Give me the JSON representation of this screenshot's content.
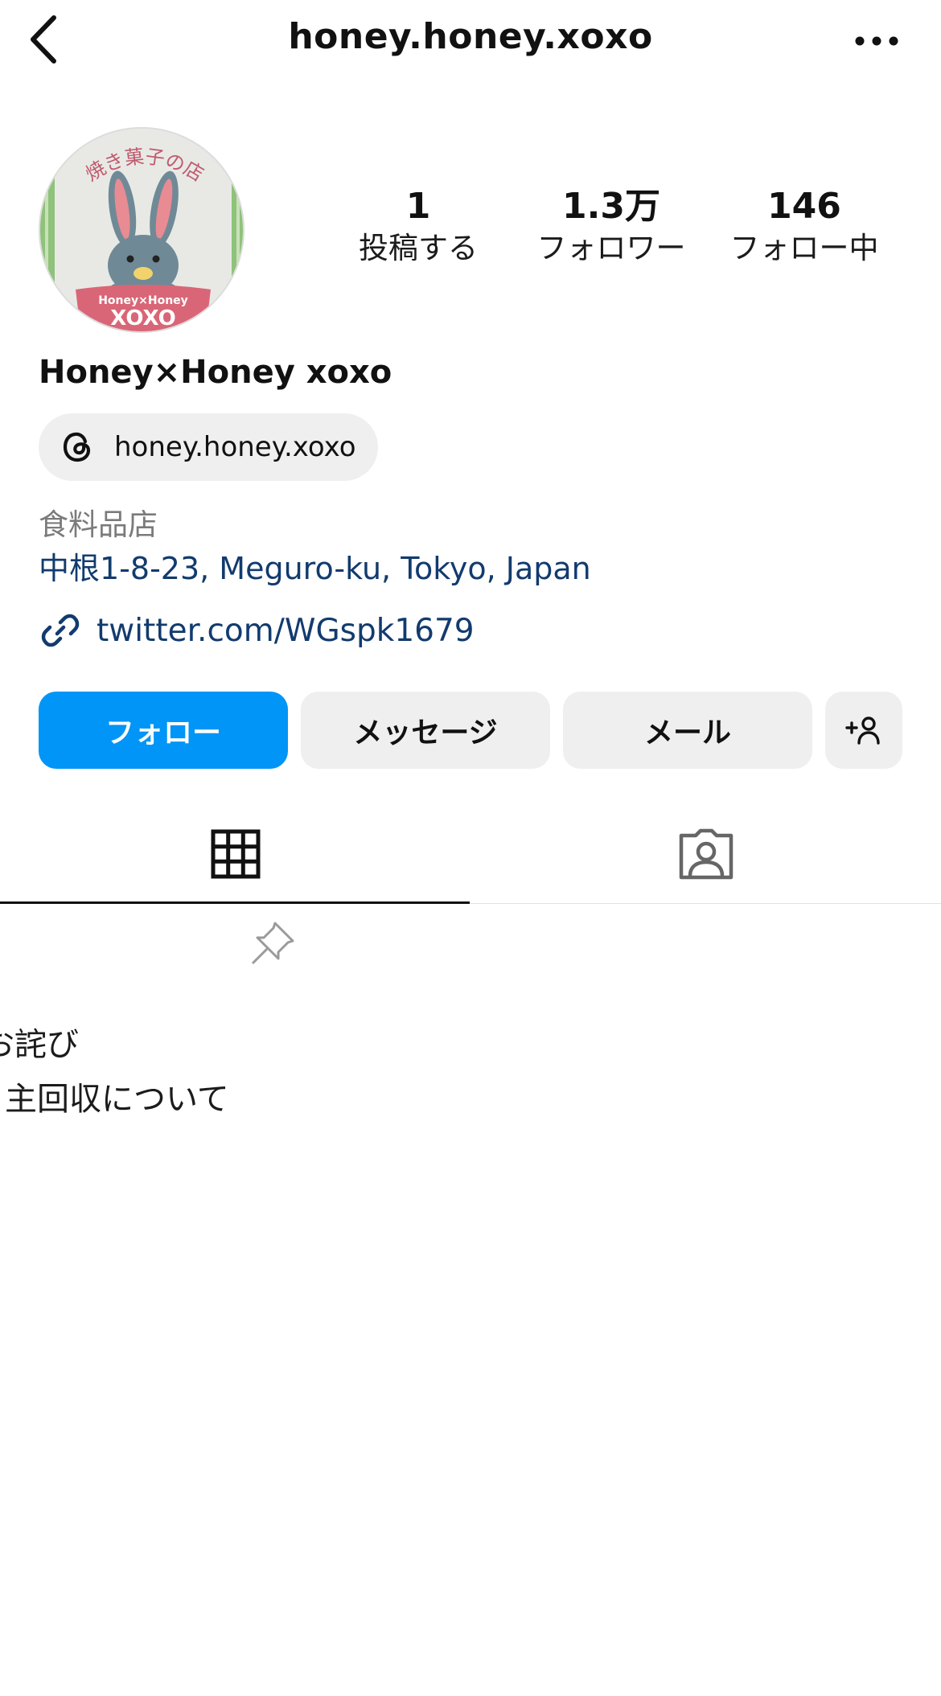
{
  "topbar": {
    "title": "honey.honey.xoxo",
    "back_icon": "chevron-left-icon",
    "more_icon": "more-horizontal-icon"
  },
  "profile": {
    "avatar_text_top": "焼き菓子の店",
    "avatar_text_brand": "Honey×Honey",
    "avatar_text_xoxo": "XOXO",
    "display_name": "Honey×Honey xoxo",
    "threads_handle": "honey.honey.xoxo",
    "category": "食料品店",
    "address": "中根1-8-23, Meguro-ku, Tokyo, Japan",
    "link": "twitter.com/WGspk1679"
  },
  "stats": {
    "posts": {
      "value": "1",
      "label": "投稿する"
    },
    "followers": {
      "value": "1.3万",
      "label": "フォロワー"
    },
    "following": {
      "value": "146",
      "label": "フォロー中"
    }
  },
  "actions": {
    "follow": "フォロー",
    "message": "メッセージ",
    "mail": "メール"
  },
  "tabs": {
    "items": [
      "posts-grid",
      "tagged"
    ],
    "active": "posts-grid"
  },
  "post": {
    "line1": "お詫び",
    "line2": "主回収について"
  },
  "colors": {
    "accent": "#0095f6",
    "link": "#123b6e",
    "chip": "#efefef"
  }
}
